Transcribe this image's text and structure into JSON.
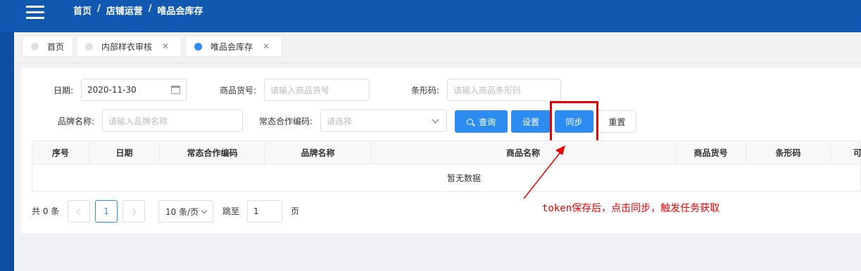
{
  "breadcrumb": {
    "home": "首页",
    "ops": "店铺运营",
    "current": "唯品会库存",
    "separator": "/"
  },
  "tabs": [
    {
      "label": "首页",
      "closable": false,
      "active": false
    },
    {
      "label": "内部样衣审核",
      "closable": true,
      "active": false
    },
    {
      "label": "唯品会库存",
      "closable": true,
      "active": true
    }
  ],
  "filters": {
    "date_label": "日期:",
    "date_value": "2020-11-30",
    "sku_label": "商品货号:",
    "sku_placeholder": "请输入商品货号",
    "barcode_label": "条形码:",
    "barcode_placeholder": "请输入商品条形码",
    "brand_label": "品牌名称:",
    "brand_placeholder": "请输入品牌名称",
    "coop_label": "常态合作编码:",
    "coop_placeholder": "请选择"
  },
  "buttons": {
    "query": "查询",
    "settings": "设置",
    "sync": "同步",
    "reset": "重置"
  },
  "table": {
    "columns": [
      "序号",
      "日期",
      "常态合作编码",
      "品牌名称",
      "商品名称",
      "商品货号",
      "条形码",
      "可售"
    ],
    "empty_text": "暂无数据"
  },
  "pager": {
    "total": "共 0 条",
    "current_page": "1",
    "page_size": "10 条/页",
    "jump_label": "跳至",
    "jump_value": "1",
    "page_suffix": "页"
  },
  "annotation": {
    "text": "token保存后，点击同步，触发任务获取",
    "color": "#e60000"
  },
  "colors": {
    "topbar": "#1158b0",
    "primary": "#2d8cf0",
    "annotation": "#e60000"
  },
  "icons": [
    "menu-icon",
    "calendar-icon",
    "chevron-down-icon",
    "search-icon",
    "close-icon",
    "chevron-left-icon",
    "chevron-right-icon"
  ]
}
